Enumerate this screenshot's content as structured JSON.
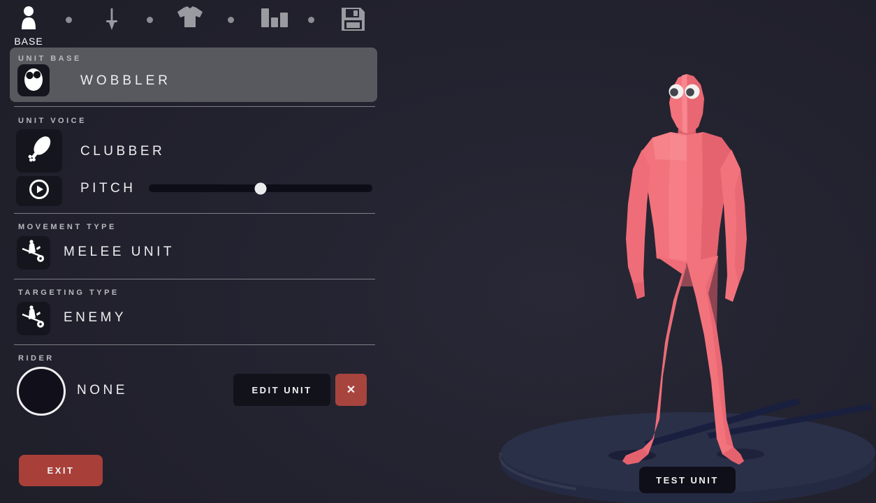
{
  "toolbar": {
    "tabs": [
      {
        "label": "BASE",
        "icon": "person-icon",
        "active": true
      },
      {
        "icon": "sword-icon",
        "active": false
      },
      {
        "icon": "shirt-icon",
        "active": false
      },
      {
        "icon": "bar-chart-icon",
        "active": false
      },
      {
        "icon": "save-icon",
        "active": false
      }
    ]
  },
  "sections": {
    "unit_base": {
      "label": "UNIT BASE",
      "value": "WOBBLER",
      "icon": "wobbler-face-icon"
    },
    "unit_voice": {
      "label": "UNIT VOICE",
      "value": "CLUBBER",
      "icon": "club-icon",
      "pitch_label": "PITCH",
      "pitch_percent": 50,
      "play_icon": "play-icon"
    },
    "movement_type": {
      "label": "MOVEMENT TYPE",
      "value": "MELEE UNIT",
      "icon": "melee-unit-icon"
    },
    "targeting_type": {
      "label": "TARGETING TYPE",
      "value": "ENEMY",
      "icon": "target-unit-icon"
    },
    "rider": {
      "label": "RIDER",
      "value": "NONE",
      "edit_label": "EDIT UNIT",
      "remove_label": "✕"
    }
  },
  "buttons": {
    "exit_label": "EXIT",
    "test_unit_label": "TEST UNIT"
  },
  "viewport": {
    "character": "wobbler",
    "character_color": "#f3737d"
  },
  "colors": {
    "background": "#23222f",
    "panel_highlight": "#58585f",
    "tile_dark": "#15151e",
    "accent_red": "#a8443e",
    "button_dark": "#10101a",
    "character_pink": "#f3737d",
    "platform_top": "#2b3049"
  }
}
